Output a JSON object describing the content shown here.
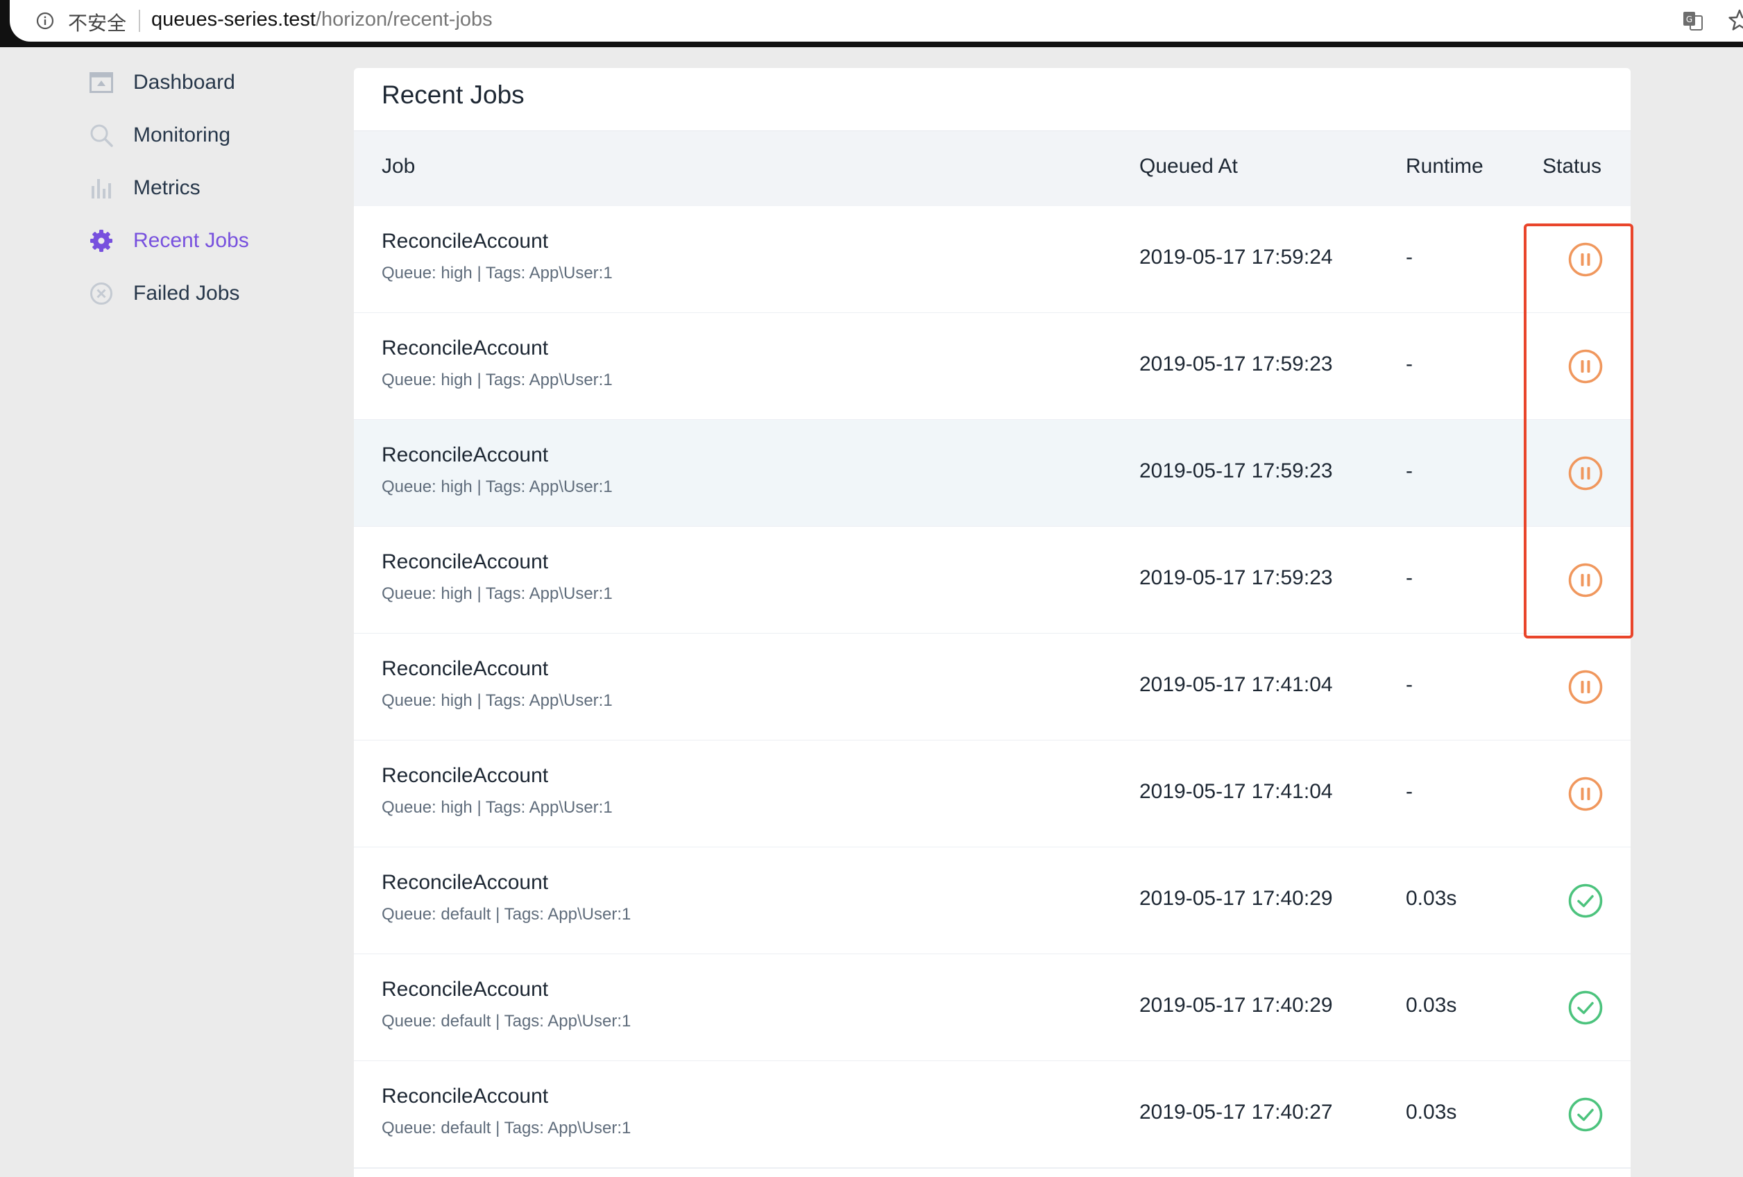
{
  "browser": {
    "security_label": "不安全",
    "url_host": "queues-series.test",
    "url_path": "/horizon/recent-jobs"
  },
  "sidebar": {
    "items": [
      {
        "label": "Dashboard",
        "icon": "dashboard-icon",
        "active": false
      },
      {
        "label": "Monitoring",
        "icon": "search-icon",
        "active": false
      },
      {
        "label": "Metrics",
        "icon": "bar-chart-icon",
        "active": false
      },
      {
        "label": "Recent Jobs",
        "icon": "gear-icon",
        "active": true
      },
      {
        "label": "Failed Jobs",
        "icon": "x-circle-icon",
        "active": false
      }
    ]
  },
  "main": {
    "title": "Recent Jobs",
    "columns": {
      "job": "Job",
      "queued_at": "Queued At",
      "runtime": "Runtime",
      "status": "Status"
    },
    "rows": [
      {
        "name": "ReconcileAccount",
        "meta": "Queue: high | Tags: App\\User:1",
        "queued_at": "2019-05-17 17:59:24",
        "runtime": "-",
        "status": "pending"
      },
      {
        "name": "ReconcileAccount",
        "meta": "Queue: high | Tags: App\\User:1",
        "queued_at": "2019-05-17 17:59:23",
        "runtime": "-",
        "status": "pending"
      },
      {
        "name": "ReconcileAccount",
        "meta": "Queue: high | Tags: App\\User:1",
        "queued_at": "2019-05-17 17:59:23",
        "runtime": "-",
        "status": "pending"
      },
      {
        "name": "ReconcileAccount",
        "meta": "Queue: high | Tags: App\\User:1",
        "queued_at": "2019-05-17 17:59:23",
        "runtime": "-",
        "status": "pending"
      },
      {
        "name": "ReconcileAccount",
        "meta": "Queue: high | Tags: App\\User:1",
        "queued_at": "2019-05-17 17:41:04",
        "runtime": "-",
        "status": "pending"
      },
      {
        "name": "ReconcileAccount",
        "meta": "Queue: high | Tags: App\\User:1",
        "queued_at": "2019-05-17 17:41:04",
        "runtime": "-",
        "status": "pending"
      },
      {
        "name": "ReconcileAccount",
        "meta": "Queue: default | Tags: App\\User:1",
        "queued_at": "2019-05-17 17:40:29",
        "runtime": "0.03s",
        "status": "completed"
      },
      {
        "name": "ReconcileAccount",
        "meta": "Queue: default | Tags: App\\User:1",
        "queued_at": "2019-05-17 17:40:29",
        "runtime": "0.03s",
        "status": "completed"
      },
      {
        "name": "ReconcileAccount",
        "meta": "Queue: default | Tags: App\\User:1",
        "queued_at": "2019-05-17 17:40:27",
        "runtime": "0.03s",
        "status": "completed"
      }
    ]
  },
  "colors": {
    "accent": "#7750de",
    "pending": "#f0975d",
    "completed": "#4cc37d",
    "annotation": "#e9452b"
  }
}
